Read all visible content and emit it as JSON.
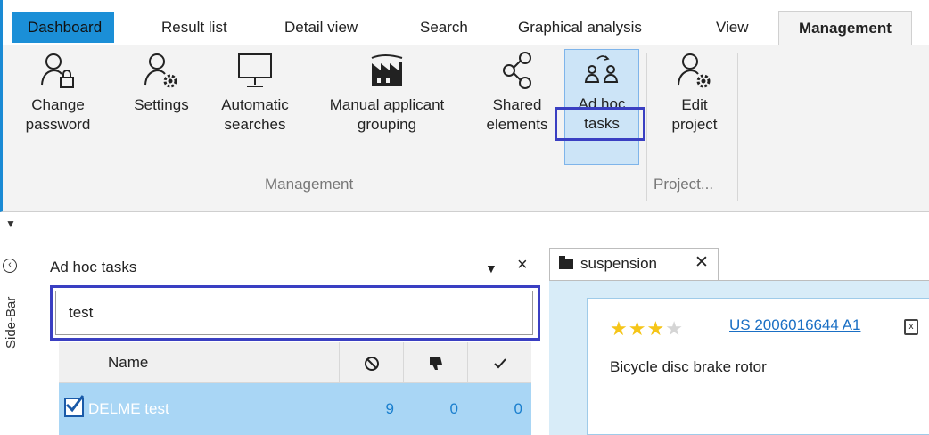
{
  "tabs": [
    {
      "label": "Dashboard"
    },
    {
      "label": "Result list"
    },
    {
      "label": "Detail view"
    },
    {
      "label": "Search"
    },
    {
      "label": "Graphical analysis"
    },
    {
      "label": "View"
    },
    {
      "label": "Management"
    }
  ],
  "active_tab": "Management",
  "ribbon": {
    "buttons": [
      {
        "line1": "Change",
        "line2": "password",
        "icon": "user-lock-icon"
      },
      {
        "line1": "Settings",
        "line2": "",
        "icon": "user-gear-icon"
      },
      {
        "line1": "Automatic",
        "line2": "searches",
        "icon": "monitor-icon"
      },
      {
        "line1": "Manual applicant",
        "line2": "grouping",
        "icon": "factory-icon"
      },
      {
        "line1": "Shared",
        "line2": "elements",
        "icon": "share-icon"
      },
      {
        "line1": "Ad hoc",
        "line2": "tasks",
        "icon": "users-transfer-icon"
      },
      {
        "line1": "Edit",
        "line2": "project",
        "icon": "user-gear-icon"
      }
    ],
    "groups": [
      {
        "label": "Management"
      },
      {
        "label": "Project..."
      }
    ]
  },
  "sidebar": {
    "label": "Side-Bar"
  },
  "panel": {
    "title": "Ad hoc tasks",
    "search_value": "test",
    "columns": [
      {
        "label": "Name"
      },
      {
        "label": "",
        "icon": "blocked-icon"
      },
      {
        "label": "",
        "icon": "thumbs-down-icon"
      },
      {
        "label": "",
        "icon": "checkmark-icon"
      }
    ],
    "rows": [
      {
        "name": "DELME test",
        "blocked": "9",
        "rejected": "0",
        "accepted": "0",
        "checked": true
      }
    ]
  },
  "document": {
    "tab_label": "suspension",
    "rating": 3,
    "rating_max": 5,
    "publication": "US 2006016644 A1",
    "title": "Bicycle disc brake rotor"
  },
  "colors": {
    "accent": "#1b8fd7",
    "highlight": "#3a3fc2",
    "row_selected": "#a9d6f5",
    "star": "#f5c518"
  }
}
